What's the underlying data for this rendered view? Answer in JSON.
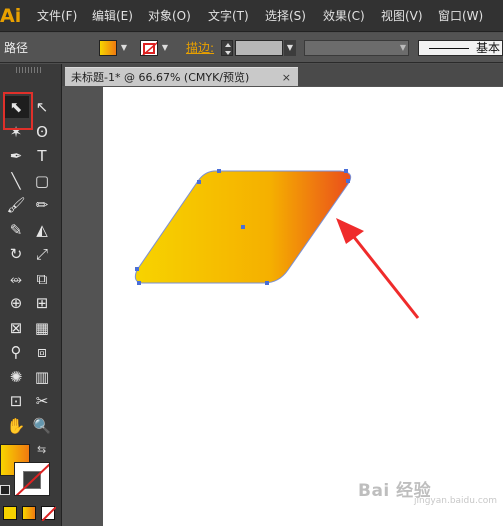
{
  "app": {
    "logo": "Ai"
  },
  "menu": [
    "文件(F)",
    "编辑(E)",
    "对象(O)",
    "文字(T)",
    "选择(S)",
    "效果(C)",
    "视图(V)",
    "窗口(W)"
  ],
  "control_bar": {
    "selection_label": "路径",
    "stroke_label": "描边:",
    "brush_label": "基本"
  },
  "document_tab": {
    "title": "未标题-1* @ 66.67% (CMYK/预览)",
    "close": "×"
  },
  "toolbox": {
    "tools": [
      "selection-tool",
      "direct-selection-tool",
      "magic-wand-tool",
      "lasso-tool",
      "pen-tool",
      "type-tool",
      "line-segment-tool",
      "rectangle-tool",
      "paintbrush-tool",
      "pencil-tool",
      "blob-brush-tool",
      "eraser-tool",
      "rotate-tool",
      "scale-tool",
      "width-tool",
      "free-transform-tool",
      "shape-builder-tool",
      "perspective-grid-tool",
      "mesh-tool",
      "gradient-tool",
      "eyedropper-tool",
      "blend-tool",
      "symbol-sprayer-tool",
      "column-graph-tool",
      "artboard-tool",
      "slice-tool",
      "hand-tool",
      "zoom-tool"
    ],
    "icons": [
      "⬉",
      "↖",
      "✶",
      "ʘ",
      "✒",
      "T",
      "╲",
      "▢",
      "🖌",
      "✏",
      "✎",
      "◭",
      "↻",
      "⤢",
      "⥈",
      "⧉",
      "⊕",
      "⊞",
      "⊠",
      "▦",
      "⚲",
      "⧈",
      "✺",
      "▥",
      "⊡",
      "✂",
      "✋",
      "🔍"
    ]
  },
  "shape": {
    "gradient_start": "#f7d300",
    "gradient_end": "#ea4c1c"
  },
  "colors": {
    "accent": "#e8a000",
    "highlight_box": "#e0302a",
    "arrow": "#ef2b2b",
    "anchor": "#4a6fd8"
  },
  "watermark": {
    "text": "Bai  经验",
    "sub": "jingyan.baidu.com"
  }
}
